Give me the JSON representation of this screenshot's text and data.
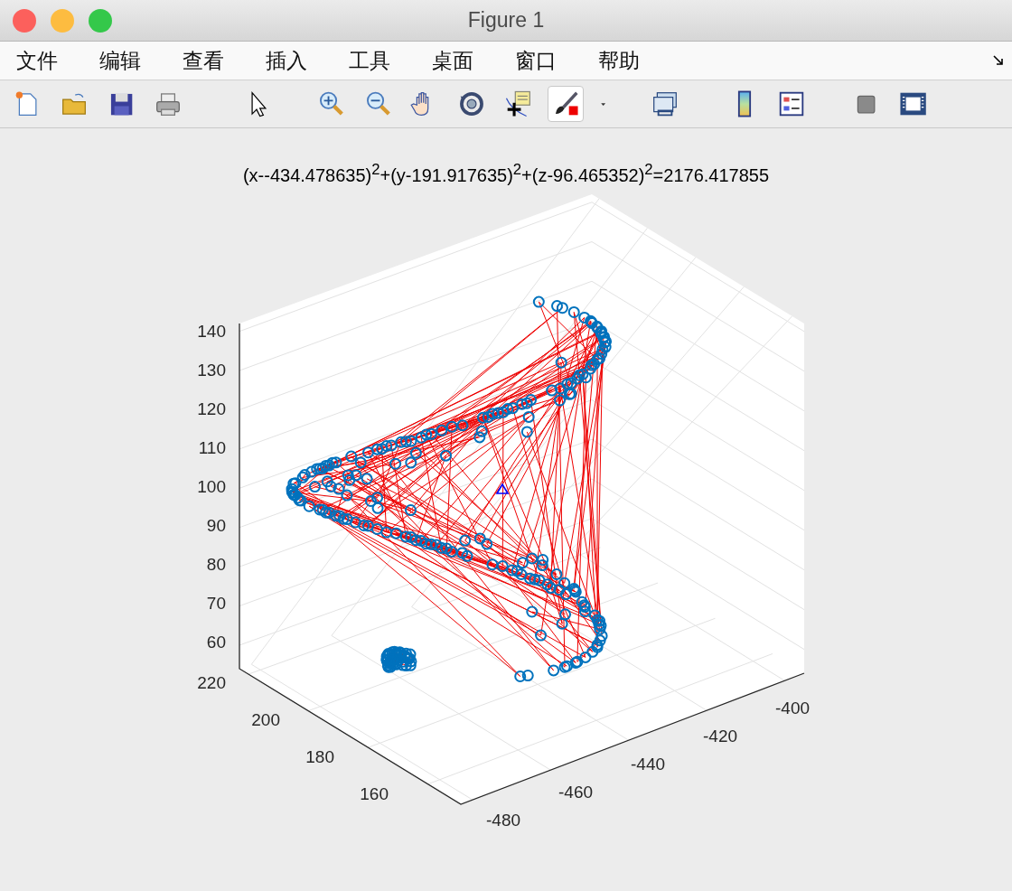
{
  "window": {
    "title": "Figure 1"
  },
  "menu": [
    "文件",
    "编辑",
    "查看",
    "插入",
    "工具",
    "桌面",
    "窗口",
    "帮助"
  ],
  "toolbar": [
    {
      "kind": "new",
      "selected": false
    },
    {
      "kind": "open",
      "selected": false
    },
    {
      "kind": "save",
      "selected": false
    },
    {
      "kind": "print",
      "selected": false
    },
    {
      "kind": "pointer",
      "selected": false
    },
    {
      "kind": "zoom-in",
      "selected": false
    },
    {
      "kind": "zoom-out",
      "selected": false
    },
    {
      "kind": "pan",
      "selected": false
    },
    {
      "kind": "rotate",
      "selected": false
    },
    {
      "kind": "data-cursor",
      "selected": false
    },
    {
      "kind": "brush",
      "selected": true
    },
    {
      "kind": "dropdown",
      "selected": false
    },
    {
      "kind": "link",
      "selected": false
    },
    {
      "kind": "colorbar",
      "selected": false
    },
    {
      "kind": "legend",
      "selected": false
    },
    {
      "kind": "hide-tools",
      "selected": false
    },
    {
      "kind": "plot-tools",
      "selected": false
    }
  ],
  "plot": {
    "title": "(x--434.478635)$^{2}$+(y-191.917635)$^{2}$+(z-96.465352)$^{2}$=2176.417855",
    "z_ticks": [
      "140",
      "130",
      "120",
      "110",
      "100",
      "90",
      "80",
      "70",
      "60"
    ],
    "y_ticks": [
      "220",
      "200",
      "180",
      "160"
    ],
    "x_ticks": [
      "-480",
      "-460",
      "-440",
      "-420",
      "-400"
    ]
  }
}
